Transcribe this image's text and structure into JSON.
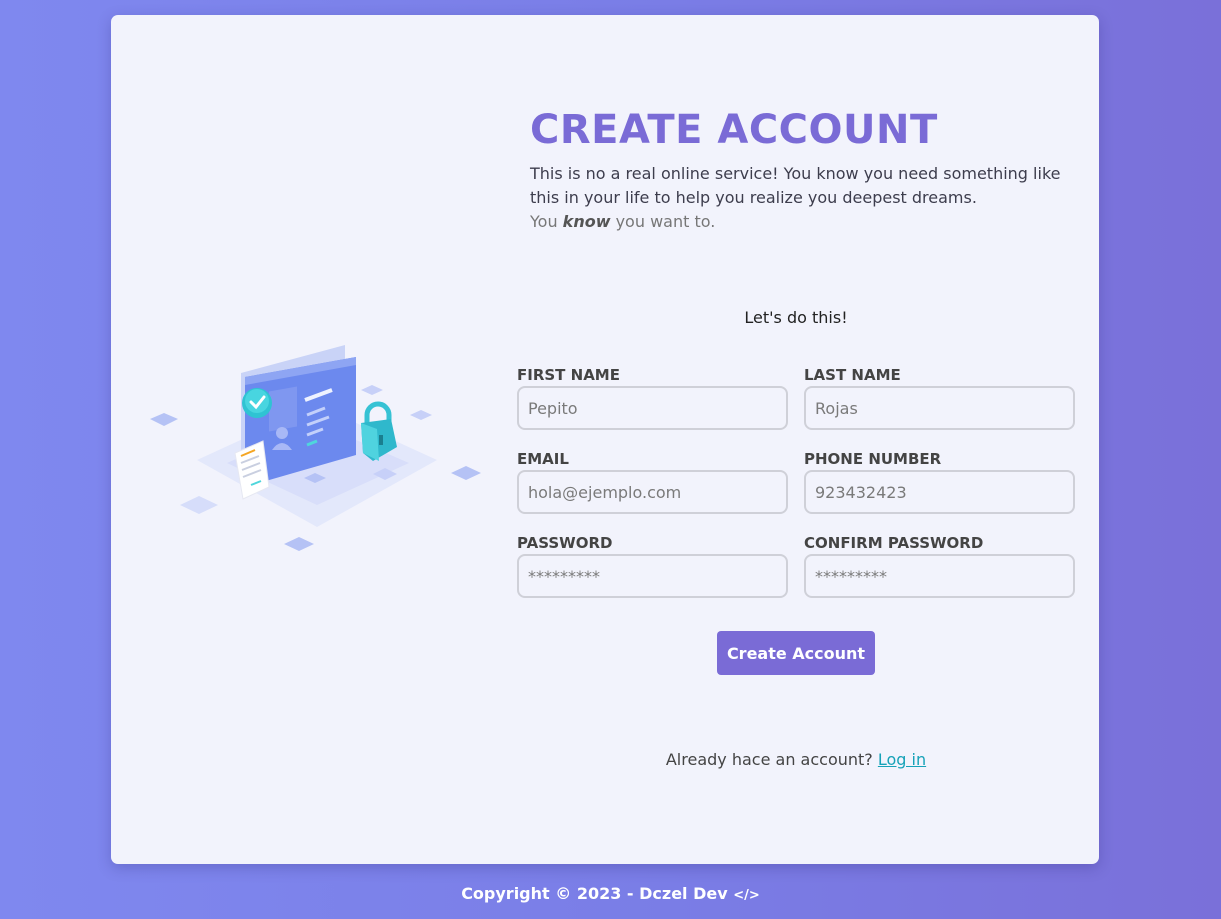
{
  "header": {
    "title": "CREATE ACCOUNT",
    "description": "This is no a real online service! You know you need something like this in your life to help you realize you deepest dreams.",
    "tagline_prefix": "You",
    "tagline_emphasis": "know",
    "tagline_suffix": "you want to."
  },
  "form": {
    "intro": "Let's do this!",
    "first_name": {
      "label": "FIRST NAME",
      "placeholder": "Pepito"
    },
    "last_name": {
      "label": "LAST NAME",
      "placeholder": "Rojas"
    },
    "email": {
      "label": "EMAIL",
      "placeholder": "hola@ejemplo.com"
    },
    "phone": {
      "label": "PHONE NUMBER",
      "placeholder": "923432423"
    },
    "password": {
      "label": "PASSWORD",
      "placeholder": "*********"
    },
    "confirm_password": {
      "label": "CONFIRM PASSWORD",
      "placeholder": "*********"
    },
    "submit_label": "Create Account"
  },
  "login_prompt": {
    "text": "Already hace an account?",
    "link_label": "Log in"
  },
  "footer": {
    "copyright": "Copyright © 2023 - Dczel Dev",
    "code_icon": "</>"
  },
  "colors": {
    "accent": "#7a6bd6",
    "link": "#17a2b8",
    "card_bg": "#f2f3fc"
  },
  "icons": [
    "checkmark-badge-icon",
    "padlock-icon",
    "id-card-icon",
    "document-icon"
  ]
}
